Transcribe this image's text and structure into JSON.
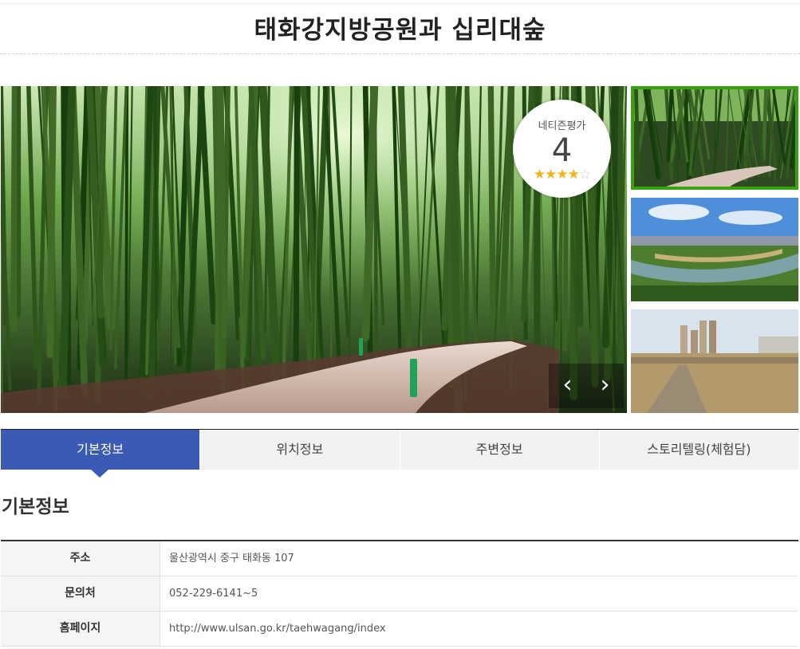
{
  "page": {
    "title": "태화강지방공원과 십리대숲"
  },
  "gallery": {
    "rating_label": "네티즌평가",
    "rating_value": "4",
    "rating": 4,
    "rating_max": 5,
    "stars_filled": "★★★★",
    "stars_empty": "☆",
    "prev_icon": "‹",
    "next_icon": "›",
    "selected_thumb_color": "#3aa10f"
  },
  "tabs": [
    {
      "label": "기본정보",
      "active": true
    },
    {
      "label": "위치정보",
      "active": false
    },
    {
      "label": "주변정보",
      "active": false
    },
    {
      "label": "스토리텔링(체험담)",
      "active": false
    }
  ],
  "section": {
    "title": "기본정보"
  },
  "info": {
    "rows": [
      {
        "label": "주소",
        "value": "울산광역시 중구 태화동 107"
      },
      {
        "label": "문의처",
        "value": "052-229-6141~5"
      },
      {
        "label": "홈페이지",
        "value": "http://www.ulsan.go.kr/taehwagang/index"
      }
    ]
  },
  "colors": {
    "accent": "#3b5ab3",
    "thumb_border": "#3aa10f",
    "star": "#f5b21b"
  }
}
